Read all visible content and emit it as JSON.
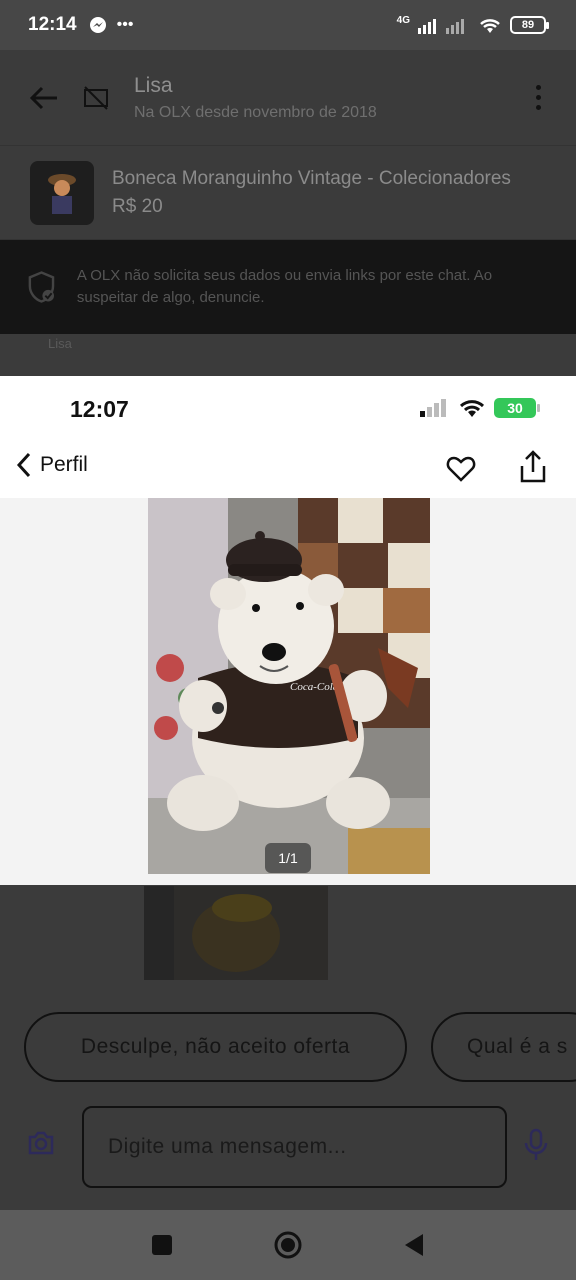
{
  "status_bar": {
    "time": "12:14",
    "network": "4G",
    "battery": "89"
  },
  "chat": {
    "contact_name": "Lisa",
    "contact_since": "Na OLX desde novembro de 2018",
    "product_title": "Boneca Moranguinho Vintage - Colecionadores",
    "product_price": "R$ 20",
    "notice": "A OLX não solicita seus dados ou envia links por este chat. Ao suspeitar de algo, denuncie.",
    "message_author": "Lisa",
    "quick_replies": [
      "Desculpe, não aceito oferta",
      "Qual é a s"
    ],
    "input_placeholder": "Digite uma mensagem..."
  },
  "viewer": {
    "time": "12:07",
    "battery": "30",
    "back_label": "Perfil",
    "counter": "1/1",
    "photo_print_text": "Coca-Cola"
  },
  "colors": {
    "overlay": "#3b3b3b",
    "viewer_bg": "#f3f3f3",
    "battery_green": "#34c759"
  },
  "icons": [
    "back-arrow-icon",
    "no-image-icon",
    "more-vert-icon",
    "shield-check-icon",
    "camera-icon",
    "mic-icon",
    "square-icon",
    "circle-icon",
    "triangle-back-icon",
    "chevron-left-icon",
    "heart-icon",
    "share-icon",
    "wifi-icon",
    "signal-icon"
  ]
}
